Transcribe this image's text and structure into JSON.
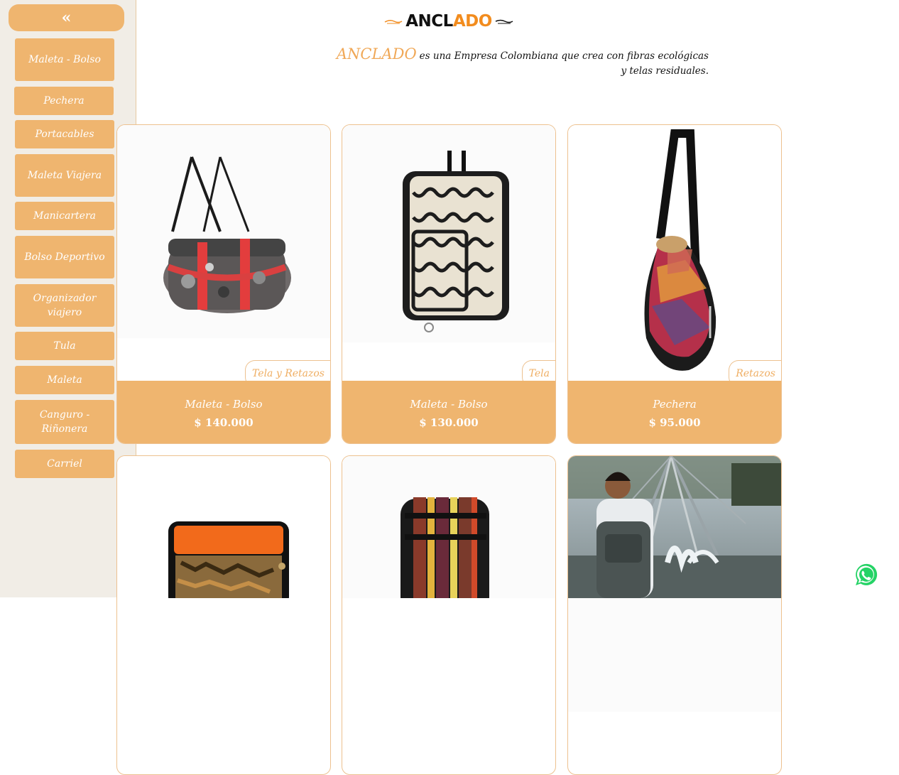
{
  "sidebar": {
    "collapse_label": "«",
    "items": [
      {
        "label": "Maleta - Bolso"
      },
      {
        "label": "Pechera"
      },
      {
        "label": "Portacables"
      },
      {
        "label": "Maleta Viajera"
      },
      {
        "label": "Manicartera"
      },
      {
        "label": "Bolso Deportivo"
      },
      {
        "label": "Organizador viajero"
      },
      {
        "label": "Tula"
      },
      {
        "label": "Maleta"
      },
      {
        "label": "Canguro - Riñonera"
      },
      {
        "label": "Carriel"
      }
    ]
  },
  "header": {
    "logo_text_start": "ANCL",
    "logo_text_accent": "A",
    "logo_text_mid": "D",
    "logo_text_end": "O",
    "tagline_brand": "ANCLADO",
    "tagline_text": "es una Empresa Colombiana que crea con fibras ecológicas y telas residuales."
  },
  "products": [
    {
      "name": "Maleta - Bolso",
      "price": "$ 140.000",
      "material": "Tela y Retazos"
    },
    {
      "name": "Maleta - Bolso",
      "price": "$ 130.000",
      "material": "Tela"
    },
    {
      "name": "Pechera",
      "price": "$ 95.000",
      "material": "Retazos"
    }
  ],
  "colors": {
    "accent": "#efb56f",
    "sidebar_bg": "#f1ede6",
    "whatsapp": "#25d366"
  }
}
